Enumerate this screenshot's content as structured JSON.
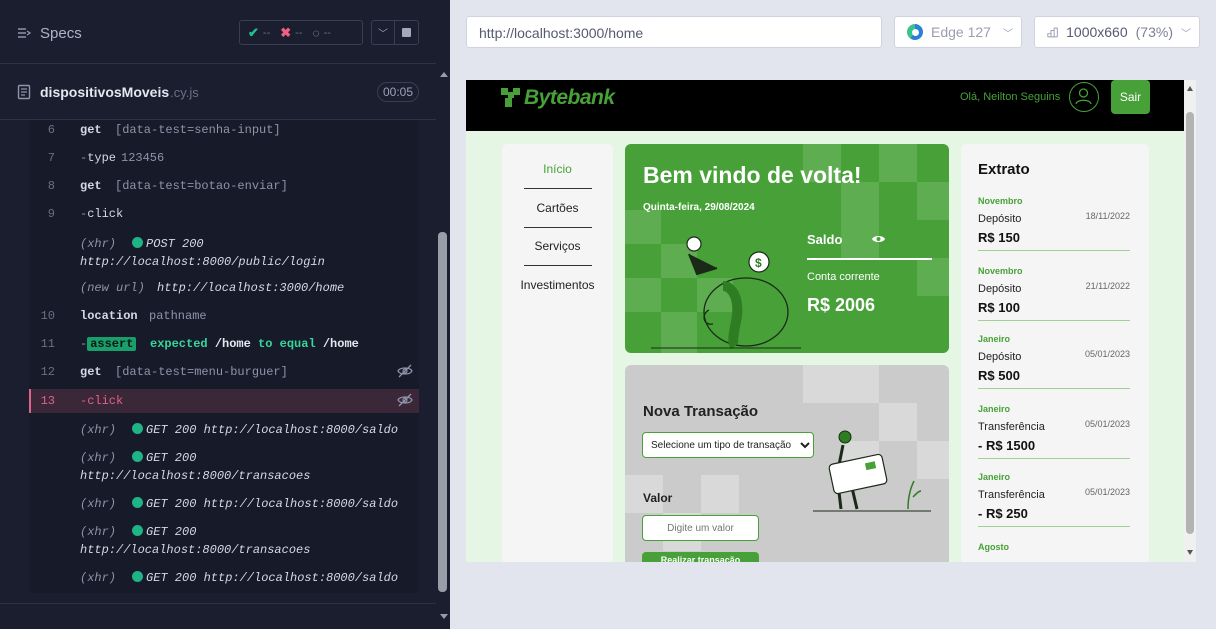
{
  "reporter": {
    "specs_label": "Specs",
    "stats": {
      "passed": "--",
      "failed": "--",
      "pending": "--"
    },
    "spec": {
      "name": "dispositivosMoveis",
      "ext": ".cy.js",
      "timer": "00:05"
    },
    "commands": [
      {
        "num": "6",
        "name": "get",
        "message": "[data-test=senha-input]"
      },
      {
        "num": "7",
        "name": "type",
        "message": "123456",
        "child": true
      },
      {
        "num": "8",
        "name": "get",
        "message": "[data-test=botao-enviar]"
      },
      {
        "num": "9",
        "name": "click",
        "message": "",
        "child": true
      },
      {
        "num": "10",
        "name": "location",
        "message": "pathname"
      },
      {
        "num": "12",
        "name": "get",
        "message": "[data-test=menu-burguer]"
      },
      {
        "num": "13",
        "name": "click",
        "message": "",
        "child": true
      }
    ],
    "xhr1": {
      "pre": "(xhr)",
      "method": "POST 200",
      "url": "http://localhost:8000/public/login"
    },
    "newurl": {
      "pre": "(new url)",
      "url": "http://localhost:3000/home"
    },
    "assert": {
      "num": "11",
      "tag": "assert",
      "expected": "expected",
      "val1": "/home",
      "mid": "to equal",
      "val2": "/home"
    },
    "xhrs": [
      {
        "pre": "(xhr)",
        "text": "GET 200 http://localhost:8000/saldo",
        "line2": ""
      },
      {
        "pre": "(xhr)",
        "text": "GET 200",
        "line2": "http://localhost:8000/transacoes"
      },
      {
        "pre": "(xhr)",
        "text": "GET 200 http://localhost:8000/saldo",
        "line2": ""
      },
      {
        "pre": "(xhr)",
        "text": "GET 200",
        "line2": "http://localhost:8000/transacoes"
      },
      {
        "pre": "(xhr)",
        "text": "GET 200 http://localhost:8000/saldo",
        "line2": ""
      }
    ]
  },
  "browser": {
    "url": "http://localhost:3000/home",
    "name": "Edge 127",
    "viewport": "1000x660",
    "scale": "(73%)"
  },
  "app": {
    "logo": "Bytebank",
    "greeting": "Olá, Neilton Seguins",
    "logout": "Sair",
    "menu": [
      "Início",
      "Cartões",
      "Serviços",
      "Investimentos"
    ],
    "welcome": {
      "title": "Bem vindo de volta!",
      "date": "Quinta-feira, 29/08/2024",
      "saldo_label": "Saldo",
      "account_label": "Conta corrente",
      "balance": "R$ 2006"
    },
    "new_tx": {
      "title": "Nova Transação",
      "select_value": "Selecione um tipo de transação",
      "value_label": "Valor",
      "value_placeholder": "Digite um valor",
      "submit": "Realizar transação"
    },
    "statement": {
      "title": "Extrato",
      "items": [
        {
          "month": "Novembro",
          "type": "Depósito",
          "date": "18/11/2022",
          "value": "R$ 150"
        },
        {
          "month": "Novembro",
          "type": "Depósito",
          "date": "21/11/2022",
          "value": "R$ 100"
        },
        {
          "month": "Janeiro",
          "type": "Depósito",
          "date": "05/01/2023",
          "value": "R$ 500"
        },
        {
          "month": "Janeiro",
          "type": "Transferência",
          "date": "05/01/2023",
          "value": "- R$ 1500"
        },
        {
          "month": "Janeiro",
          "type": "Transferência",
          "date": "05/01/2023",
          "value": "- R$ 250"
        },
        {
          "month": "Agosto",
          "type": "",
          "date": "",
          "value": ""
        }
      ]
    },
    "colors": {
      "brand": "#47a138",
      "header": "#000000",
      "background": "#e6f6e4"
    }
  }
}
